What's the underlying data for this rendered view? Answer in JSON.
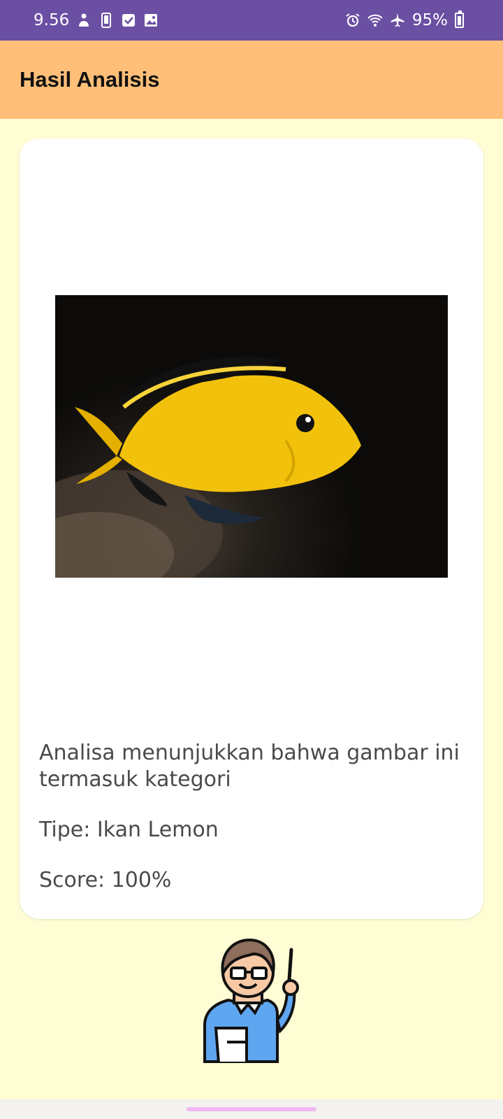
{
  "status_bar": {
    "time": "9.56",
    "battery": "95%",
    "left_icons": [
      "person-icon",
      "phone-icon",
      "check-box-icon",
      "gallery-icon"
    ],
    "right_icons": [
      "alarm-icon",
      "wifi-icon",
      "airplane-icon",
      "battery-icon"
    ]
  },
  "app_bar": {
    "title": "Hasil Analisis",
    "color": "#FFBF78"
  },
  "result": {
    "description": "Analisa menunjukkan bahwa gambar ini termasuk kategori",
    "type": "Tipe: Ikan Lemon",
    "score": "Score: 100%"
  },
  "colors": {
    "status_bar": "#6A4FA3",
    "background": "#FFFDD4",
    "card": "#FFFFFF",
    "text": "#4A4A4A",
    "nav_handle": "#F1B8F0"
  }
}
